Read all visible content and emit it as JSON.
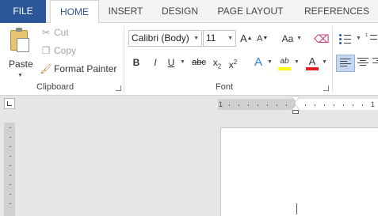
{
  "tabs": [
    {
      "label": "FILE"
    },
    {
      "label": "HOME"
    },
    {
      "label": "INSERT"
    },
    {
      "label": "DESIGN"
    },
    {
      "label": "PAGE LAYOUT"
    },
    {
      "label": "REFERENCES"
    }
  ],
  "clipboard": {
    "paste_label": "Paste",
    "cut_label": "Cut",
    "copy_label": "Copy",
    "format_painter_label": "Format Painter",
    "group_label": "Clipboard"
  },
  "font": {
    "font_name": "Calibri (Body)",
    "font_size": "11",
    "grow_label": "A",
    "shrink_label": "A",
    "case_label": "Aa",
    "bold_label": "B",
    "italic_label": "I",
    "underline_label": "U",
    "strike_label": "abc",
    "subscript_label": "x",
    "subscript_mark": "2",
    "superscript_label": "x",
    "superscript_mark": "2",
    "effects_label": "A",
    "highlight_label": "ab",
    "color_label": "A",
    "group_label": "Font",
    "highlight_color": "#ffff00",
    "font_color": "#e02020",
    "effects_color": "#2f7fd6"
  },
  "ruler": {
    "labels": [
      "1",
      "1"
    ]
  },
  "colors": {
    "file_tab": "#2b579a",
    "active_tab_text": "#2b579a",
    "ribbon_bg": "#ffffff",
    "workspace_bg": "#e6e6e6"
  }
}
